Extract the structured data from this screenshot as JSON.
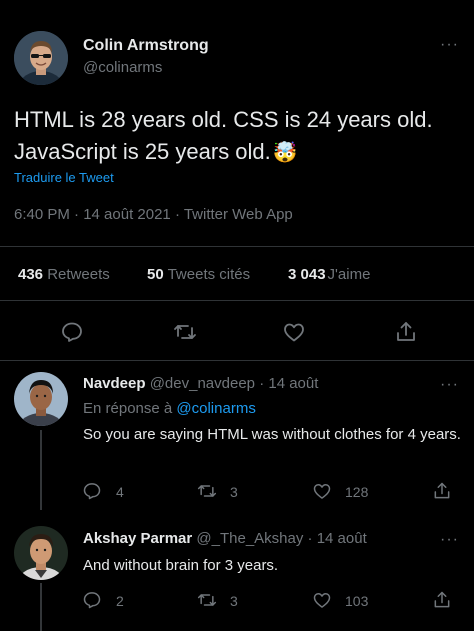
{
  "main_tweet": {
    "author_name": "Colin Armstrong",
    "author_handle": "@colinarms",
    "text": "HTML is 28 years old. CSS is 24 years old. JavaScript is 25 years old.",
    "emoji": "🤯",
    "translate_label": "Traduire le Tweet",
    "timestamp": "6:40 PM · 14 août 2021 · Twitter Web App",
    "stats": {
      "retweets_count": "436",
      "retweets_label": "Retweets",
      "quotes_count": "50",
      "quotes_label": "Tweets cités",
      "likes_count": "3 043",
      "likes_label": "J'aime"
    }
  },
  "replies": [
    {
      "author_name": "Navdeep",
      "author_handle": "@dev_navdeep",
      "date": "· 14 août",
      "reply_to_prefix": "En réponse à",
      "reply_to_handle": "@colinarms",
      "text": "So you are saying HTML was without clothes for 4 years.",
      "replies": "4",
      "retweets": "3",
      "likes": "128"
    },
    {
      "author_name": "Akshay Parmar",
      "author_handle": "@_The_Akshay",
      "date": "· 14 août",
      "text": "And without brain for 3 years.",
      "replies": "2",
      "retweets": "3",
      "likes": "103"
    }
  ],
  "more_label": "···",
  "colors": {
    "background": "#000000",
    "text": "#e7e9ea",
    "muted": "#71767b",
    "link": "#1d9bf0",
    "divider": "#2f3336"
  }
}
